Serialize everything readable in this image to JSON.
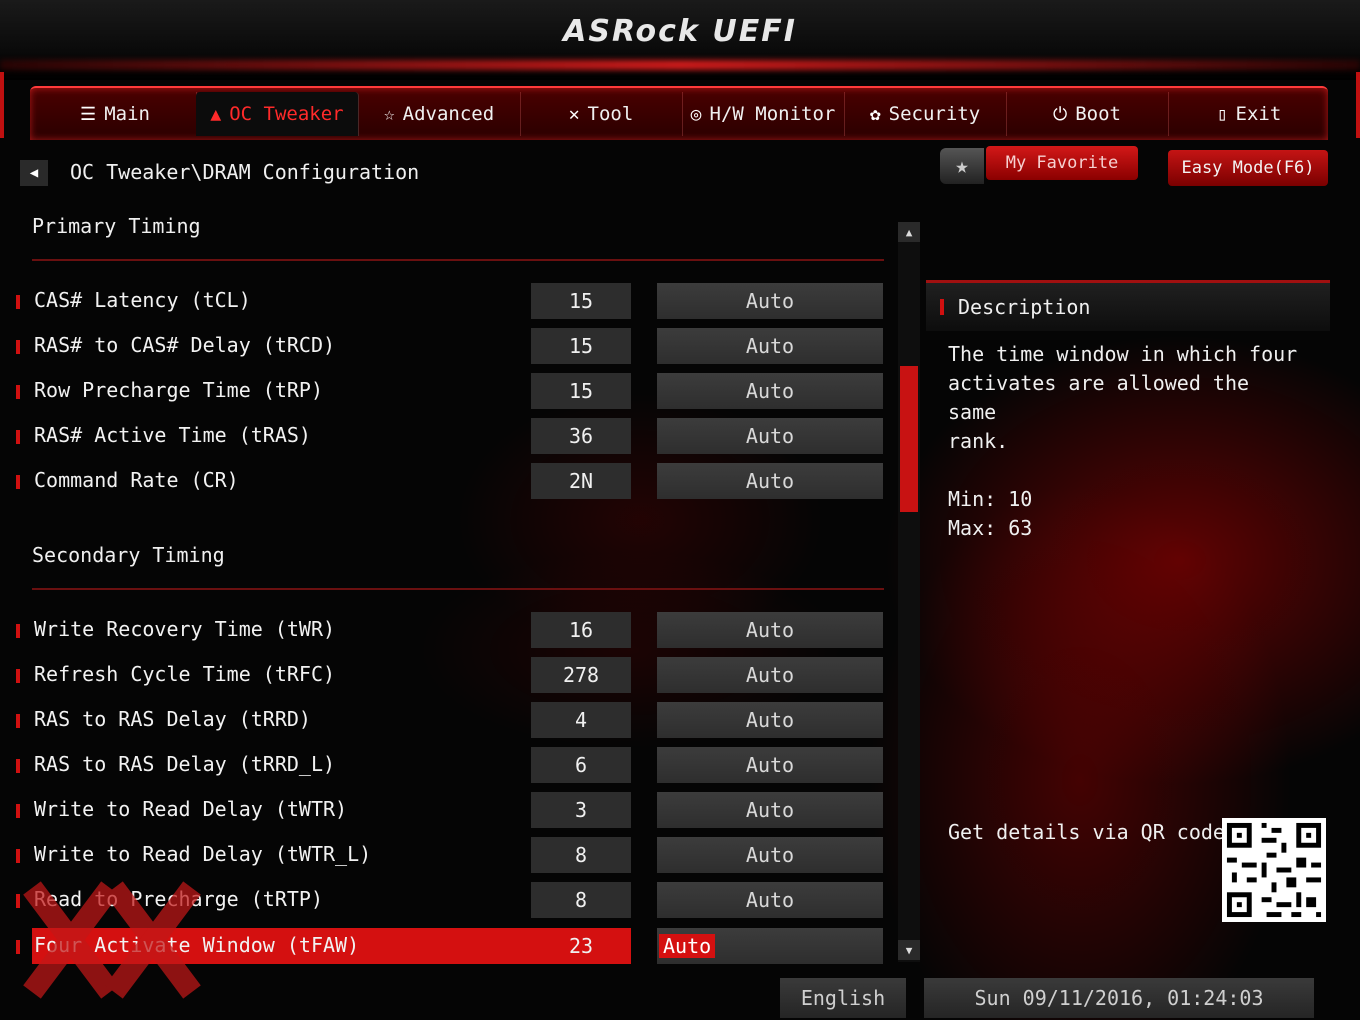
{
  "app": {
    "title": "ASRock UEFI"
  },
  "tabs": [
    {
      "label": "Main",
      "icon": "list-icon",
      "active": false
    },
    {
      "label": "OC Tweaker",
      "icon": "flame-icon",
      "active": true
    },
    {
      "label": "Advanced",
      "icon": "star-icon",
      "active": false
    },
    {
      "label": "Tool",
      "icon": "tools-icon",
      "active": false
    },
    {
      "label": "H/W Monitor",
      "icon": "monitor-icon",
      "active": false
    },
    {
      "label": "Security",
      "icon": "shield-icon",
      "active": false
    },
    {
      "label": "Boot",
      "icon": "power-icon",
      "active": false
    },
    {
      "label": "Exit",
      "icon": "exit-icon",
      "active": false
    }
  ],
  "breadcrumb": {
    "path": "OC Tweaker\\DRAM Configuration"
  },
  "toolbar": {
    "favorite_label": "My Favorite",
    "easy_mode_label": "Easy Mode(F6)"
  },
  "primary": {
    "title": "Primary Timing",
    "rows": [
      {
        "label": "CAS# Latency (tCL)",
        "value": "15",
        "setting": "Auto"
      },
      {
        "label": "RAS# to CAS# Delay (tRCD)",
        "value": "15",
        "setting": "Auto"
      },
      {
        "label": "Row Precharge Time (tRP)",
        "value": "15",
        "setting": "Auto"
      },
      {
        "label": "RAS# Active Time (tRAS)",
        "value": "36",
        "setting": "Auto"
      },
      {
        "label": "Command Rate (CR)",
        "value": "2N",
        "setting": "Auto"
      }
    ]
  },
  "secondary": {
    "title": "Secondary Timing",
    "rows": [
      {
        "label": "Write Recovery Time (tWR)",
        "value": "16",
        "setting": "Auto"
      },
      {
        "label": "Refresh Cycle Time (tRFC)",
        "value": "278",
        "setting": "Auto"
      },
      {
        "label": "RAS to RAS Delay (tRRD)",
        "value": "4",
        "setting": "Auto"
      },
      {
        "label": "RAS to RAS Delay (tRRD_L)",
        "value": "6",
        "setting": "Auto"
      },
      {
        "label": "Write to Read Delay (tWTR)",
        "value": "3",
        "setting": "Auto"
      },
      {
        "label": "Write to Read Delay (tWTR_L)",
        "value": "8",
        "setting": "Auto"
      },
      {
        "label": "Read to Precharge (tRTP)",
        "value": "8",
        "setting": "Auto"
      },
      {
        "label": "Four Activate Window (tFAW)",
        "value": "23",
        "setting": "Auto",
        "selected": true
      }
    ]
  },
  "description": {
    "title": "Description",
    "lines": [
      "The time window in which four",
      "activates are allowed the same",
      "rank."
    ],
    "min": "Min: 10",
    "max": "Max: 63",
    "qr_label": "Get details via QR code"
  },
  "footer": {
    "language": "English",
    "datetime": "Sun 09/11/2016, 01:24:03"
  },
  "colors": {
    "accent": "#d41010",
    "panel": "#2d2d2d",
    "background": "#050505"
  }
}
